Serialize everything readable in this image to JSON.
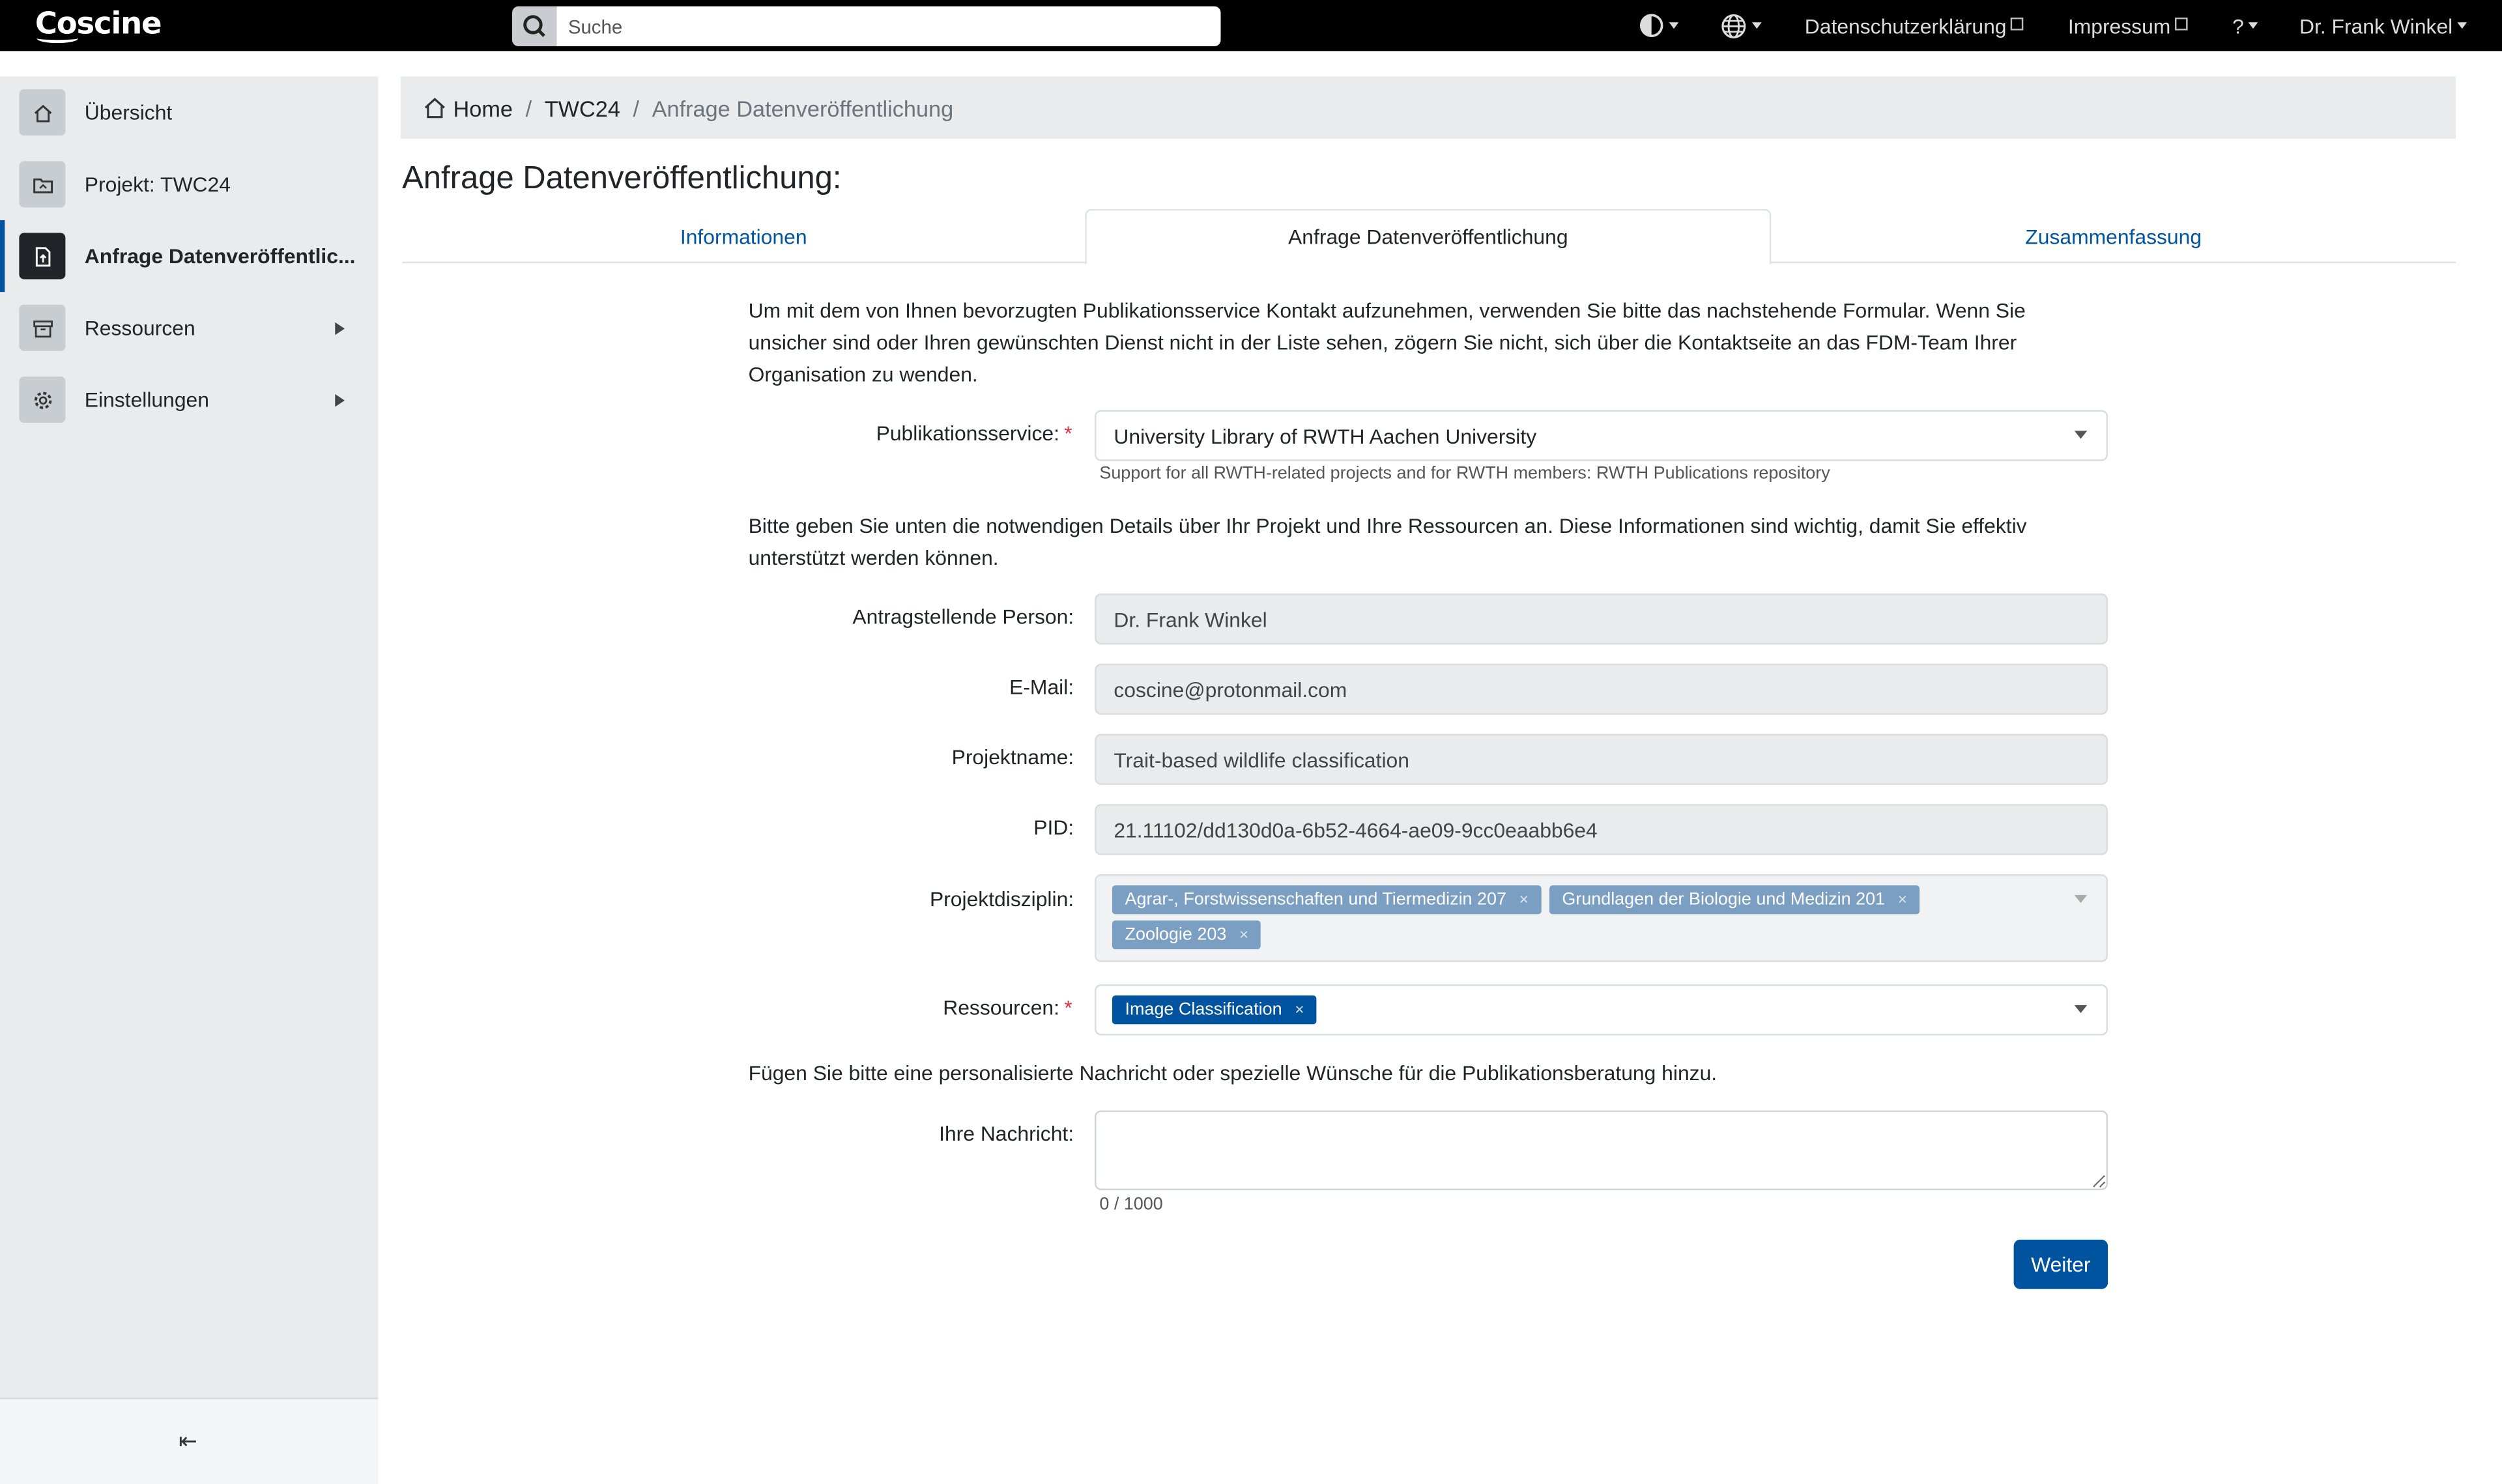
{
  "app": {
    "logo": "Coscine"
  },
  "topbar": {
    "search_placeholder": "Suche",
    "privacy": "Datenschutzerklärung",
    "imprint": "Impressum",
    "help": "?",
    "user": "Dr. Frank Winkel"
  },
  "sidebar": {
    "items": [
      {
        "label": "Übersicht",
        "icon": "home-icon"
      },
      {
        "label": "Projekt: TWC24",
        "icon": "folder-icon"
      },
      {
        "label": "Anfrage Datenveröffentlic...",
        "icon": "file-upload-icon"
      },
      {
        "label": "Ressourcen",
        "icon": "archive-icon"
      },
      {
        "label": "Einstellungen",
        "icon": "gear-icon"
      }
    ],
    "collapse": "⇤"
  },
  "breadcrumb": {
    "home": "Home",
    "project": "TWC24",
    "current": "Anfrage Datenveröffentlichung"
  },
  "page_title": "Anfrage Datenveröffentlichung:",
  "tabs": [
    "Informationen",
    "Anfrage Datenveröffentlichung",
    "Zusammenfassung"
  ],
  "form": {
    "intro": "Um mit dem von Ihnen bevorzugten Publikationsservice Kontakt aufzunehmen, verwenden Sie bitte das nachstehende Formular. Wenn Sie unsicher sind oder Ihren gewünschten Dienst nicht in der Liste sehen, zögern Sie nicht, sich über die Kontaktseite an das FDM-Team Ihrer Organisation zu wenden.",
    "service_label": "Publikationsservice:",
    "service_value": "University Library of RWTH Aachen University",
    "service_help": "Support for all RWTH-related projects and for RWTH members: RWTH Publications repository",
    "details_intro": "Bitte geben Sie unten die notwendigen Details über Ihr Projekt und Ihre Ressourcen an. Diese Informationen sind wichtig, damit Sie effektiv unterstützt werden können.",
    "applicant_label": "Antragstellende Person:",
    "applicant_value": "Dr. Frank Winkel",
    "email_label": "E-Mail:",
    "email_value": "coscine@protonmail.com",
    "project_label": "Projektname:",
    "project_value": "Trait-based wildlife classification",
    "pid_label": "PID:",
    "pid_value": "21.11102/dd130d0a-6b52-4664-ae09-9cc0eaabb6e4",
    "discipline_label": "Projektdisziplin:",
    "disciplines": [
      "Agrar-, Forstwissenschaften und Tiermedizin 207",
      "Grundlagen der Biologie und Medizin 201",
      "Zoologie 203"
    ],
    "resources_label": "Ressourcen:",
    "resources": [
      "Image Classification"
    ],
    "message_intro": "Fügen Sie bitte eine personalisierte Nachricht oder spezielle Wünsche für die Publikationsberatung hinzu.",
    "message_label": "Ihre Nachricht:",
    "message_value": "",
    "counter": "0 / 1000",
    "next_button": "Weiter",
    "required_mark": "*",
    "chip_remove": "×"
  },
  "colors": {
    "accent": "#00549f",
    "chip": "#7a9fc3",
    "required": "#dc3545",
    "topbar": "#000000",
    "sidebar": "#e9ebec"
  }
}
